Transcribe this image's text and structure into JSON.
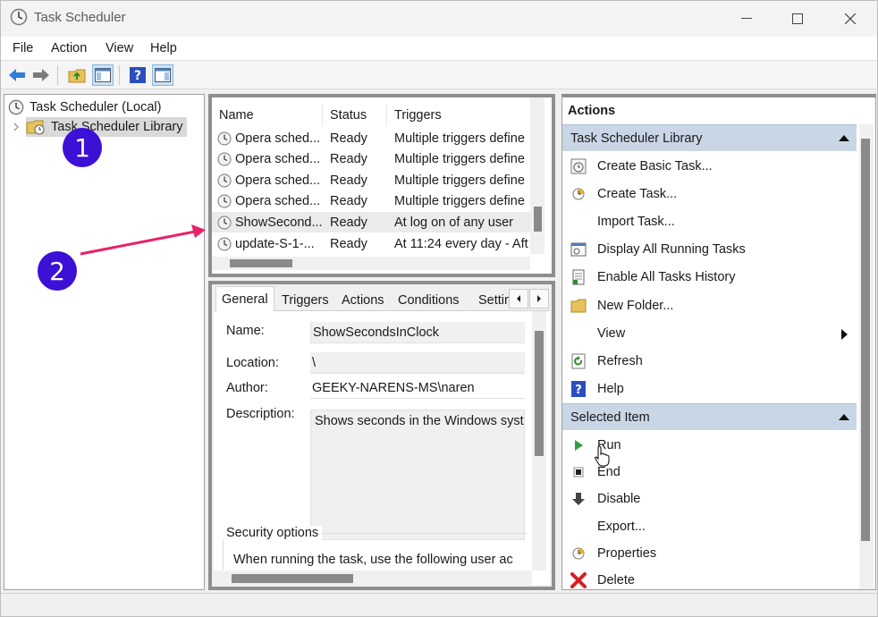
{
  "window": {
    "title": "Task Scheduler",
    "controls": [
      "minimize",
      "maximize",
      "close"
    ]
  },
  "menu": [
    "File",
    "Action",
    "View",
    "Help"
  ],
  "toolbar": {
    "buttons": [
      "back-icon",
      "forward-icon",
      "folder-up-icon",
      "show-hide-tree-icon",
      "help-icon",
      "show-hide-action-pane-icon"
    ]
  },
  "tree": {
    "root": "Task Scheduler (Local)",
    "library": "Task Scheduler Library"
  },
  "task_list": {
    "columns": [
      "Name",
      "Status",
      "Triggers"
    ],
    "rows": [
      {
        "name": "Opera sched...",
        "status": "Ready",
        "triggers": "Multiple triggers define"
      },
      {
        "name": "Opera sched...",
        "status": "Ready",
        "triggers": "Multiple triggers define"
      },
      {
        "name": "Opera sched...",
        "status": "Ready",
        "triggers": "Multiple triggers define"
      },
      {
        "name": "Opera sched...",
        "status": "Ready",
        "triggers": "Multiple triggers define"
      },
      {
        "name": "ShowSecond...",
        "status": "Ready",
        "triggers": "At log on of any user"
      },
      {
        "name": "update-S-1-...",
        "status": "Ready",
        "triggers": "At 11:24 every day - Aft"
      }
    ],
    "selected_index": 4
  },
  "detail": {
    "tabs": [
      "General",
      "Triggers",
      "Actions",
      "Conditions",
      "Settin"
    ],
    "active_tab": "General",
    "name_label": "Name:",
    "name_value": "ShowSecondsInClock",
    "location_label": "Location:",
    "location_value": "\\",
    "author_label": "Author:",
    "author_value": "GEEKY-NARENS-MS\\naren",
    "description_label": "Description:",
    "description_value": "Shows seconds in the Windows syste",
    "security_title": "Security options",
    "security_text": "When running the task, use the following user ac"
  },
  "actions": {
    "title": "Actions",
    "library_section": "Task Scheduler Library",
    "library_items": [
      {
        "label": "Create Basic Task...",
        "icon": "create-basic-task-icon"
      },
      {
        "label": "Create Task...",
        "icon": "create-task-icon"
      },
      {
        "label": "Import Task...",
        "icon": ""
      },
      {
        "label": "Display All Running Tasks",
        "icon": "running-tasks-icon"
      },
      {
        "label": "Enable All Tasks History",
        "icon": "history-icon"
      },
      {
        "label": "New Folder...",
        "icon": "folder-icon"
      },
      {
        "label": "View",
        "icon": ""
      },
      {
        "label": "Refresh",
        "icon": "refresh-icon"
      },
      {
        "label": "Help",
        "icon": "help-icon"
      }
    ],
    "selected_section": "Selected Item",
    "selected_items": [
      {
        "label": "Run",
        "icon": "run-icon"
      },
      {
        "label": "End",
        "icon": "end-icon"
      },
      {
        "label": "Disable",
        "icon": "disable-icon"
      },
      {
        "label": "Export...",
        "icon": ""
      },
      {
        "label": "Properties",
        "icon": "properties-icon"
      },
      {
        "label": "Delete",
        "icon": "delete-icon"
      }
    ]
  },
  "annotations": {
    "badge1": "1",
    "badge2": "2"
  },
  "colors": {
    "badge": "#3d10d6",
    "arrow": "#e8216a",
    "section_header": "#c9d6e5"
  }
}
